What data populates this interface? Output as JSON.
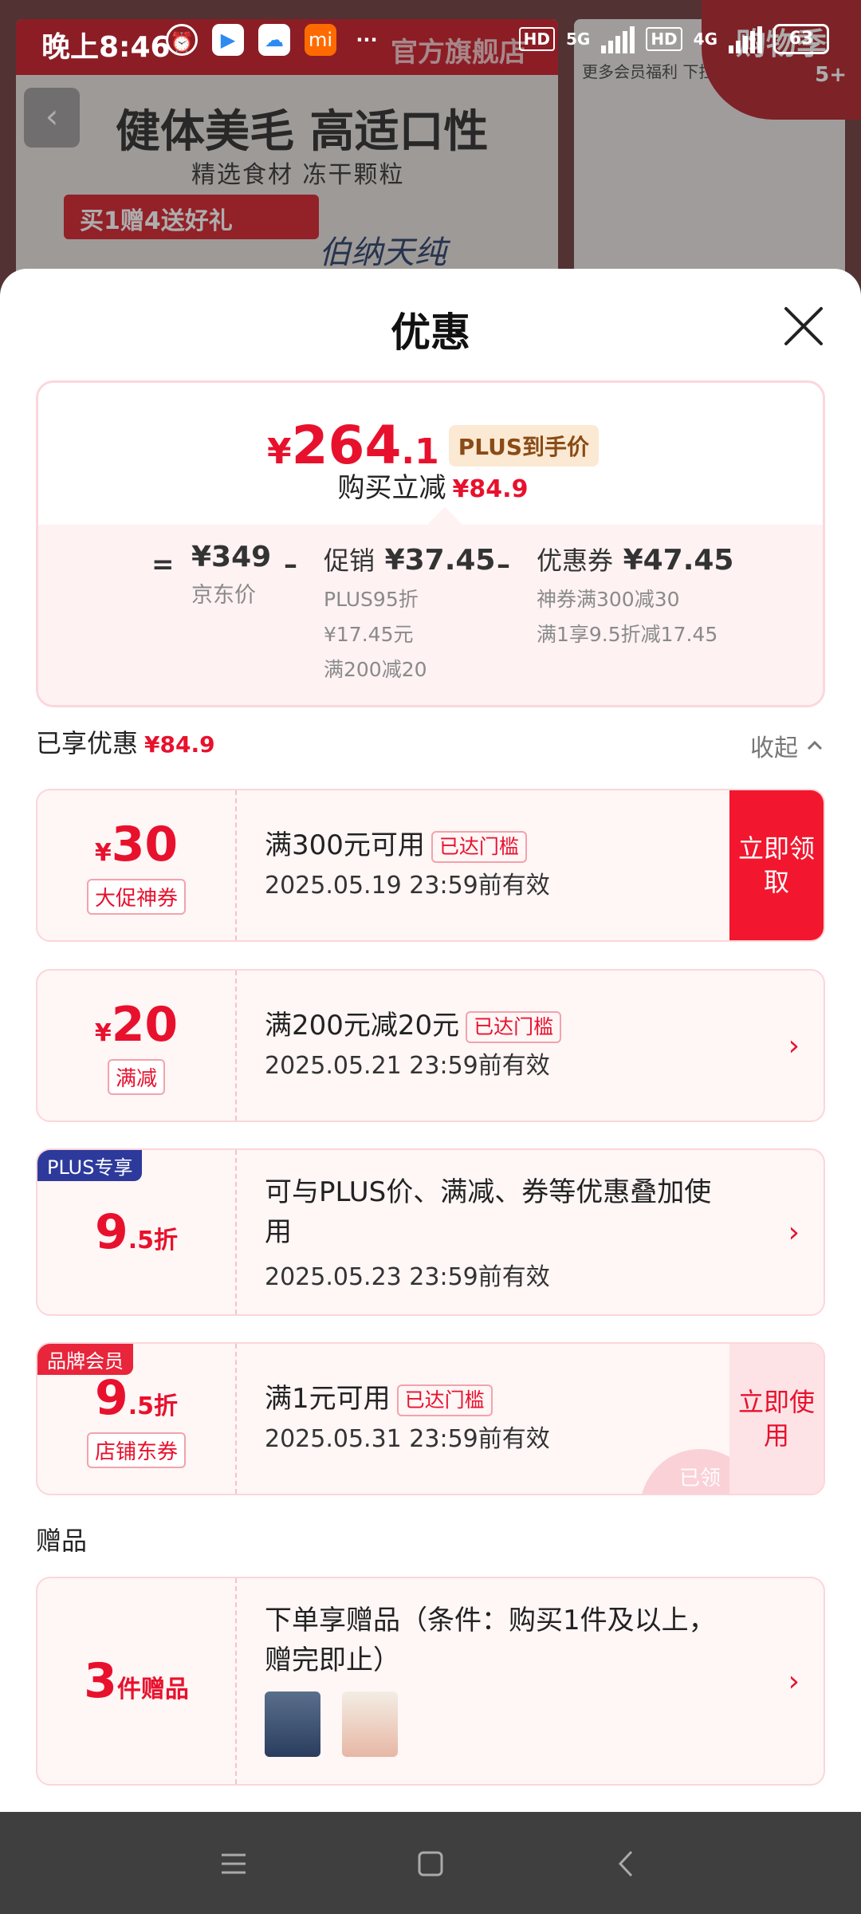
{
  "status_bar": {
    "time": "晚上8:46",
    "hd1": "HD",
    "net1": "5G",
    "hd2": "HD",
    "net2": "4G",
    "battery": "63"
  },
  "background": {
    "store_name": "官方旗舰店",
    "headline": "健体美毛 高适口性",
    "subline": "精选食材 冻干颗粒",
    "promo": "买1赠4送好礼",
    "brand": "伯纳天纯",
    "welfare": "更多会员福利 下拉",
    "corner_badge": "购物季",
    "corner_count": "5+"
  },
  "sheet": {
    "title": "优惠",
    "summary": {
      "currency": "¥",
      "price_int": "264",
      "price_dec": ".1",
      "plus_tag": "PLUS到手价",
      "reduce_label": "购买立减",
      "reduce_value": "¥84.9",
      "equals": "=",
      "jd_price": "¥349",
      "jd_price_label": "京东价",
      "minus1": "–",
      "promo_label": "促销",
      "promo_value": "¥37.45",
      "promo_detail1": "PLUS95折",
      "promo_detail2": "¥17.45元",
      "promo_detail3": "满200减20",
      "minus2": "–",
      "coupon_label": "优惠券",
      "coupon_value": "¥47.45",
      "coupon_detail1": "神券满300减30",
      "coupon_detail2": "满1享9.5折减17.45"
    },
    "used_label": "已享优惠",
    "used_value": "¥84.9",
    "collapse_label": "收起",
    "coupons": [
      {
        "currency": "¥",
        "amount": "30",
        "tag": "大促神券",
        "line1": "满300元可用",
        "reach": "已达门槛",
        "line2": "2025.05.19 23:59前有效",
        "action": "立即领取"
      },
      {
        "currency": "¥",
        "amount": "20",
        "tag": "满减",
        "line1": "满200元减20元",
        "reach": "已达门槛",
        "line2": "2025.05.21 23:59前有效"
      },
      {
        "badge": "PLUS专享",
        "amount_big": "9",
        "amount_small": ".5折",
        "line1": "可与PLUS价、满减、券等优惠叠加使用",
        "line2": "2025.05.23 23:59前有效"
      },
      {
        "badge": "品牌会员",
        "amount_big": "9",
        "amount_small": ".5折",
        "tag": "店铺东券",
        "line1": "满1元可用",
        "reach": "已达门槛",
        "line2": "2025.05.31 23:59前有效",
        "action": "立即使用",
        "stamp": "已领"
      }
    ],
    "gift_section_title": "赠品",
    "gift": {
      "amount_big": "3",
      "amount_small": "件赠品",
      "line1": "下单享赠品（条件：购买1件及以上，赠完即止）"
    }
  },
  "colors": {
    "accent_red": "#e8112d",
    "plus_blue": "#2d3a9c",
    "nav_bg": "#3f3f3f"
  }
}
